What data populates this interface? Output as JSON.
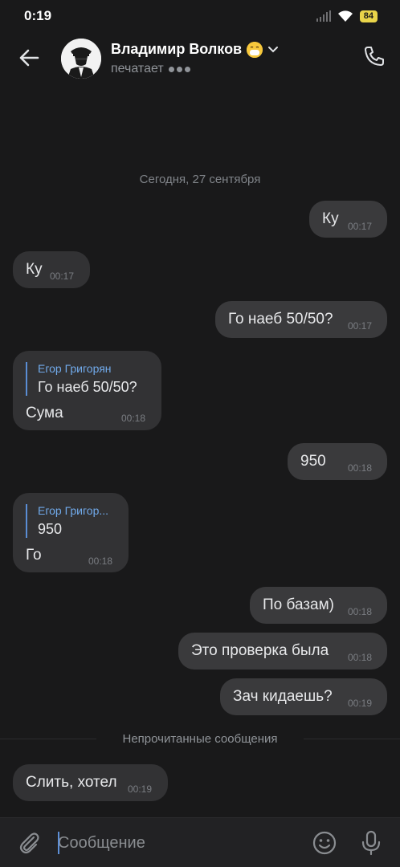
{
  "status_bar": {
    "time": "0:19",
    "battery": "84"
  },
  "header": {
    "contact_name": "Владимир Волков",
    "status": "печатает",
    "name_emoji": "😷"
  },
  "chat": {
    "date_separator": "Сегодня, 27 сентября",
    "messages": [
      {
        "direction": "out",
        "text": "Ку",
        "time": "00:17"
      },
      {
        "direction": "in",
        "text": "Ку",
        "time": "00:17"
      },
      {
        "direction": "out",
        "text": "Го наеб 50/50?",
        "time": "00:17"
      },
      {
        "direction": "in",
        "reply_name": "Егор Григорян",
        "reply_text": "Го наеб 50/50?",
        "text": "Сума",
        "time": "00:18"
      },
      {
        "direction": "out",
        "text": "950",
        "time": "00:18"
      },
      {
        "direction": "in",
        "reply_name": "Егор Григор...",
        "reply_text": "950",
        "text": "Го",
        "time": "00:18"
      },
      {
        "direction": "out",
        "text": "По базам)",
        "time": "00:18"
      },
      {
        "direction": "out",
        "text": "Это проверка была",
        "time": "00:18"
      },
      {
        "direction": "out",
        "text": "Зач кидаешь?",
        "time": "00:19"
      },
      {
        "direction": "in",
        "text": "Слить, хотел",
        "time": "00:19"
      }
    ],
    "unread_separator": "Непрочитанные сообщения"
  },
  "composer": {
    "placeholder": "Сообщение",
    "value": ""
  },
  "icons": {
    "back": "arrow-left-icon",
    "call": "phone-icon",
    "attach": "paperclip-icon",
    "emoji": "smile-icon",
    "mic": "microphone-icon"
  },
  "colors": {
    "background": "#19191a",
    "bubble": "#323234",
    "accent": "#71aaeb",
    "battery": "#e9d44a"
  }
}
